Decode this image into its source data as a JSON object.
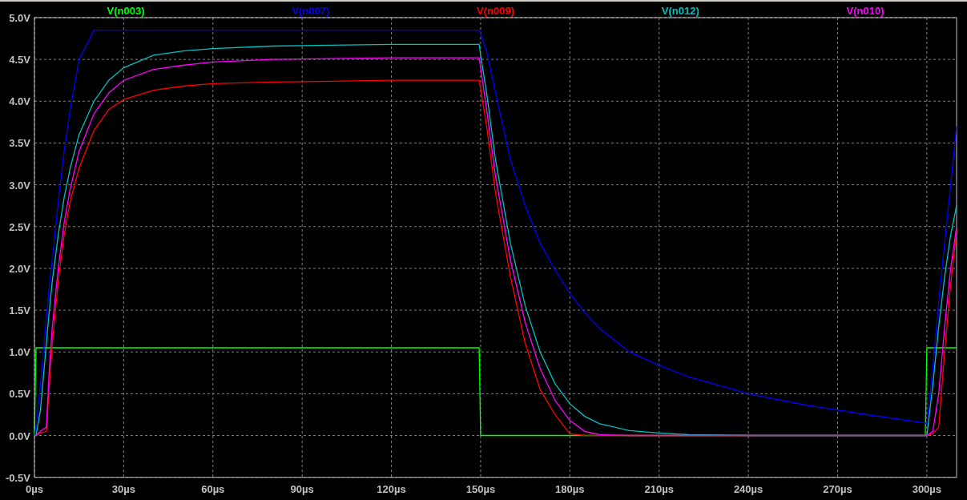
{
  "chart_data": {
    "type": "line",
    "grid": true,
    "xlim": [
      0,
      310
    ],
    "ylim": [
      -0.5,
      5
    ],
    "xticks": [
      {
        "value": 0,
        "label": "0µs"
      },
      {
        "value": 30,
        "label": "30µs"
      },
      {
        "value": 60,
        "label": "60µs"
      },
      {
        "value": 90,
        "label": "90µs"
      },
      {
        "value": 120,
        "label": "120µs"
      },
      {
        "value": 150,
        "label": "150µs"
      },
      {
        "value": 180,
        "label": "180µs"
      },
      {
        "value": 210,
        "label": "210µs"
      },
      {
        "value": 240,
        "label": "240µs"
      },
      {
        "value": 270,
        "label": "270µs"
      },
      {
        "value": 300,
        "label": "300µs"
      }
    ],
    "yticks": [
      {
        "value": 5,
        "label": "5.0V"
      },
      {
        "value": 4.5,
        "label": "4.5V"
      },
      {
        "value": 4,
        "label": "4.0V"
      },
      {
        "value": 3.5,
        "label": "3.5V"
      },
      {
        "value": 3,
        "label": "3.0V"
      },
      {
        "value": 2.5,
        "label": "2.5V"
      },
      {
        "value": 2,
        "label": "2.0V"
      },
      {
        "value": 1.5,
        "label": "1.5V"
      },
      {
        "value": 1,
        "label": "1.0V"
      },
      {
        "value": 0.5,
        "label": "0.5V"
      },
      {
        "value": 0,
        "label": "0.0V"
      },
      {
        "value": -0.5,
        "label": "-0.5V"
      }
    ],
    "x": [
      0,
      0.5,
      2,
      4,
      5,
      6,
      8,
      10,
      12,
      15,
      20,
      25,
      30,
      40,
      50,
      60,
      80,
      100,
      120,
      140,
      149.5,
      150,
      152,
      155,
      160,
      165,
      170,
      175,
      180,
      185,
      190,
      200,
      210,
      220,
      240,
      260,
      280,
      299.5,
      300,
      302,
      304,
      306,
      308,
      310
    ],
    "series": [
      {
        "name": "V(n003)",
        "color": "#00ff00",
        "values": [
          0,
          1.05,
          1.05,
          1.05,
          1.05,
          1.05,
          1.05,
          1.05,
          1.05,
          1.05,
          1.05,
          1.05,
          1.05,
          1.05,
          1.05,
          1.05,
          1.05,
          1.05,
          1.05,
          1.05,
          1.05,
          0,
          0,
          0,
          0,
          0,
          0,
          0,
          0,
          0,
          0,
          0,
          0,
          0,
          0,
          0,
          0,
          0,
          1.05,
          1.05,
          1.05,
          1.05,
          1.05,
          1.05
        ]
      },
      {
        "name": "V(n007)",
        "color": "#0000ff",
        "values": [
          0,
          0.1,
          0.6,
          1.4,
          1.8,
          2.1,
          2.8,
          3.4,
          3.9,
          4.5,
          4.85,
          4.85,
          4.85,
          4.85,
          4.85,
          4.85,
          4.85,
          4.85,
          4.85,
          4.85,
          4.85,
          4.8,
          4.6,
          4.1,
          3.3,
          2.75,
          2.3,
          1.98,
          1.7,
          1.47,
          1.28,
          1.0,
          0.84,
          0.7,
          0.5,
          0.36,
          0.25,
          0.15,
          0.14,
          0.8,
          1.6,
          2.3,
          3.0,
          3.7
        ]
      },
      {
        "name": "V(n009)",
        "color": "#ff0000",
        "values": [
          0,
          0,
          0.03,
          0.05,
          0.6,
          1.1,
          1.85,
          2.4,
          2.8,
          3.2,
          3.65,
          3.9,
          4.02,
          4.13,
          4.18,
          4.21,
          4.23,
          4.24,
          4.25,
          4.25,
          4.25,
          4.15,
          3.7,
          2.9,
          1.9,
          1.1,
          0.55,
          0.25,
          0.02,
          0,
          0,
          0,
          0,
          0,
          0,
          0,
          0,
          0,
          0,
          0.02,
          0.1,
          1.0,
          1.8,
          2.45
        ]
      },
      {
        "name": "V(n012)",
        "color": "#00c0c0",
        "values": [
          0,
          0,
          0.3,
          1.1,
          1.5,
          1.85,
          2.4,
          2.85,
          3.2,
          3.6,
          4.0,
          4.25,
          4.4,
          4.55,
          4.6,
          4.63,
          4.66,
          4.67,
          4.68,
          4.68,
          4.68,
          4.55,
          4.1,
          3.3,
          2.3,
          1.55,
          1.0,
          0.62,
          0.38,
          0.23,
          0.14,
          0.06,
          0.03,
          0.01,
          0,
          0,
          0,
          0,
          0,
          0.6,
          1.3,
          1.9,
          2.4,
          2.75
        ]
      },
      {
        "name": "V(n010)",
        "color": "#ff00ff",
        "values": [
          0,
          0,
          0.05,
          0.1,
          0.8,
          1.3,
          2.0,
          2.55,
          2.95,
          3.4,
          3.85,
          4.1,
          4.25,
          4.38,
          4.43,
          4.47,
          4.5,
          4.51,
          4.52,
          4.52,
          4.52,
          4.4,
          3.9,
          3.1,
          2.1,
          1.35,
          0.8,
          0.42,
          0.18,
          0.05,
          0.01,
          0,
          0,
          0,
          0,
          0,
          0,
          0,
          0,
          0.05,
          0.5,
          1.3,
          2.0,
          2.5
        ]
      }
    ]
  }
}
